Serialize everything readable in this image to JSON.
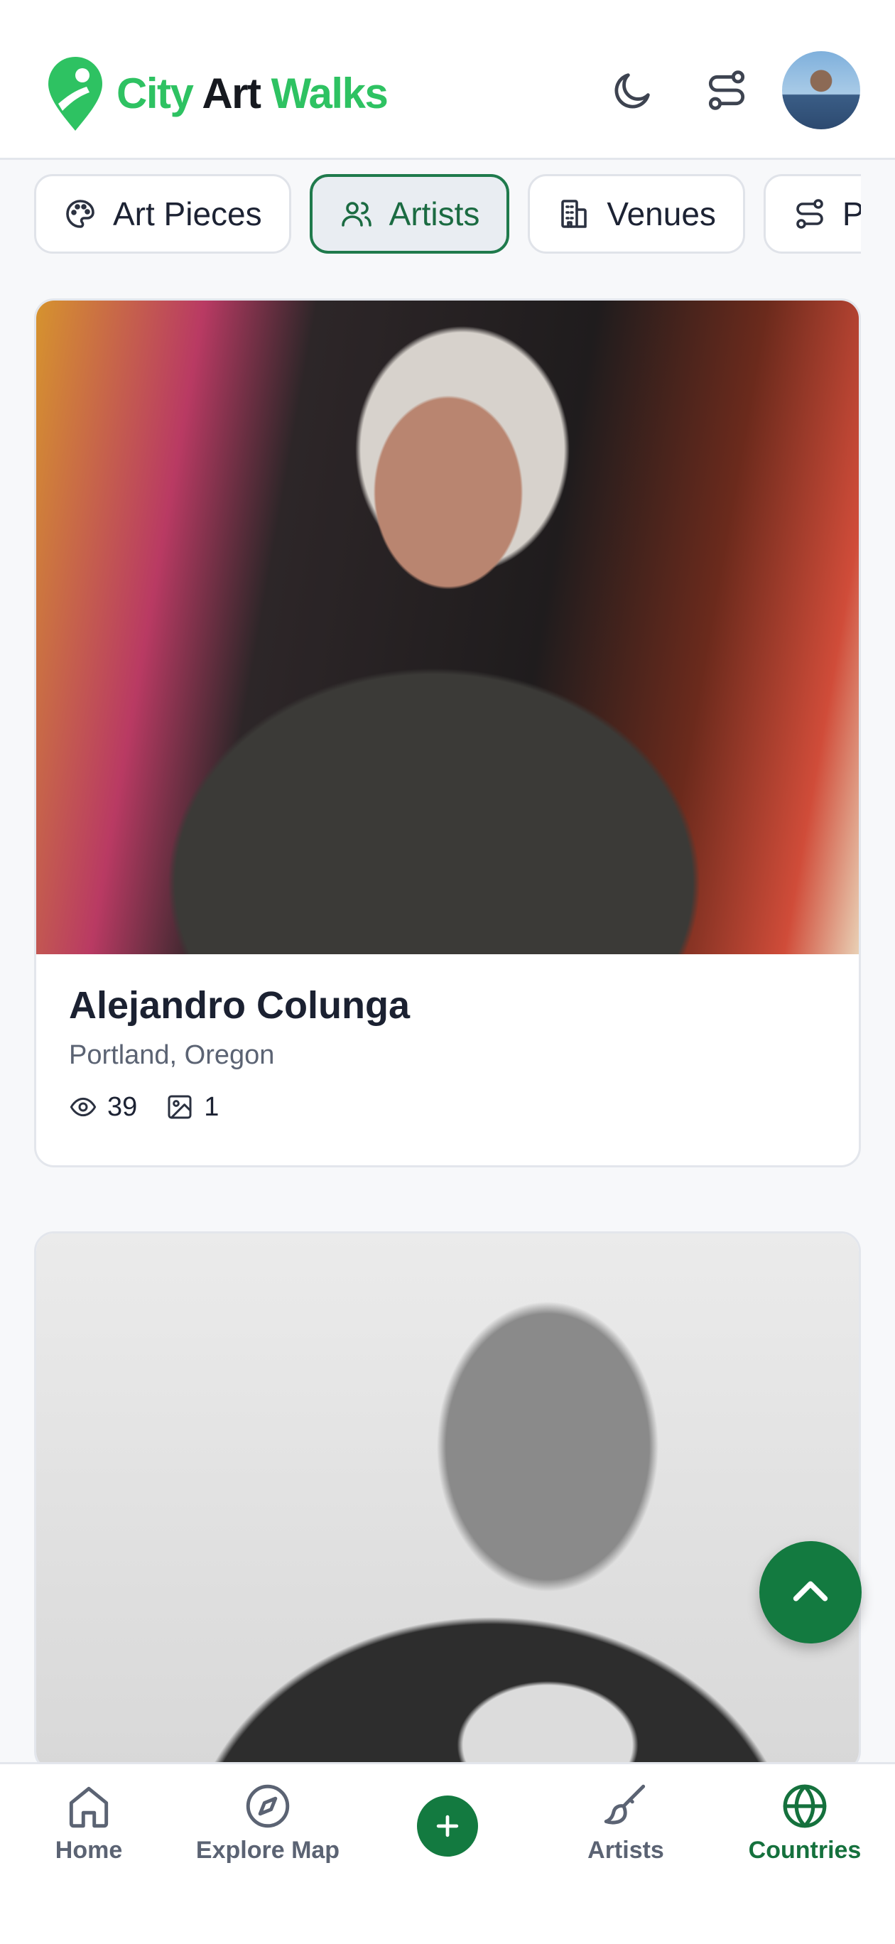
{
  "header": {
    "logo_part1": "City",
    "logo_part2": "Art",
    "logo_part3": "Walks",
    "icons": [
      "map-pin-logo",
      "moon-icon",
      "route-icon",
      "avatar"
    ]
  },
  "tabs": [
    {
      "label": "Art Pieces",
      "icon": "palette-icon",
      "active": false
    },
    {
      "label": "Artists",
      "icon": "users-icon",
      "active": true
    },
    {
      "label": "Venues",
      "icon": "building-icon",
      "active": false
    },
    {
      "label": "Paths",
      "icon": "route-icon",
      "active": false
    }
  ],
  "cards": [
    {
      "name": "Alejandro Colunga",
      "location": "Portland, Oregon",
      "views": "39",
      "images": "1"
    },
    {
      "name": "",
      "location": "",
      "views": "",
      "images": ""
    }
  ],
  "bottom_nav": [
    {
      "label": "Home",
      "icon": "home-icon",
      "active": false
    },
    {
      "label": "Explore Map",
      "icon": "compass-icon",
      "active": false
    },
    {
      "label": "",
      "icon": "plus-icon",
      "active": false
    },
    {
      "label": "Artists",
      "icon": "brush-icon",
      "active": false
    },
    {
      "label": "Countries",
      "icon": "globe-icon",
      "active": true
    }
  ],
  "colors": {
    "accent": "#137a40",
    "logo_green": "#2ec262",
    "active_tab_border": "#1f7a4c"
  }
}
